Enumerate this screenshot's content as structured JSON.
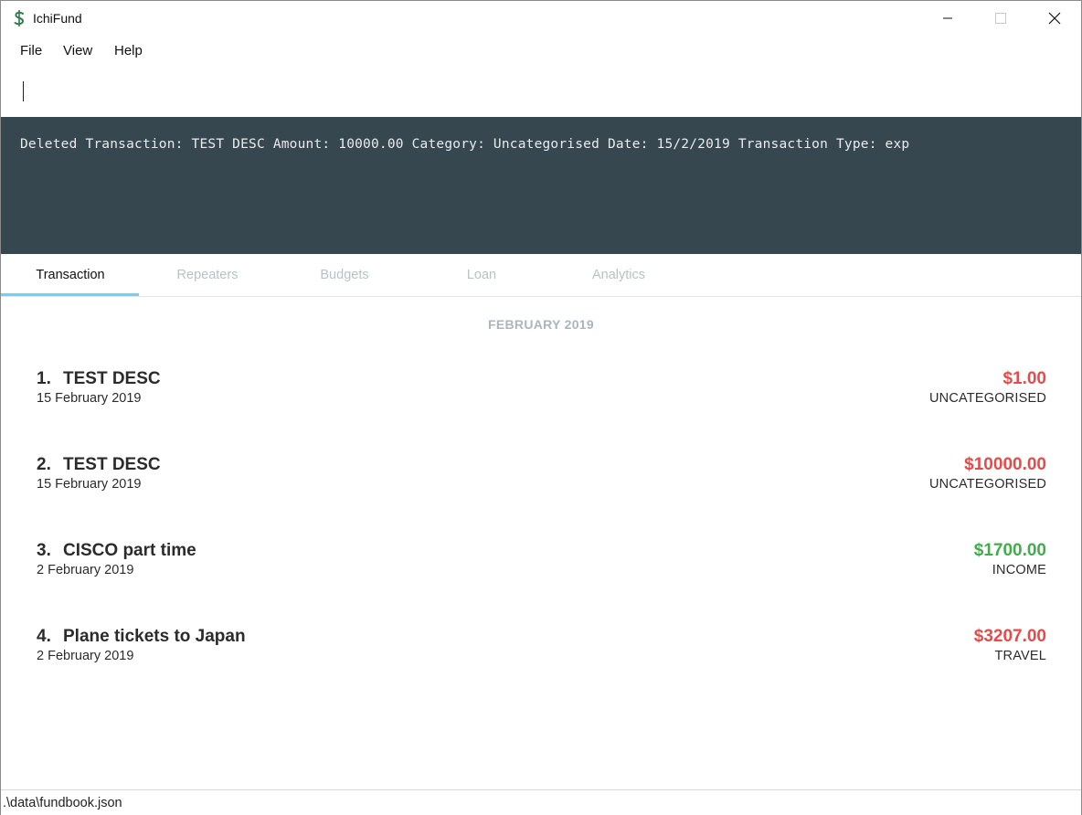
{
  "window": {
    "title": "IchiFund",
    "icon": "dollar-leaf-icon"
  },
  "menu": {
    "items": [
      {
        "label": "File"
      },
      {
        "label": "View"
      },
      {
        "label": "Help"
      }
    ]
  },
  "command": {
    "value": ""
  },
  "result": {
    "text": "Deleted Transaction: TEST DESC Amount: 10000.00 Category: Uncategorised Date: 15/2/2019 Transaction Type: exp"
  },
  "tabs": [
    {
      "label": "Transaction",
      "active": true
    },
    {
      "label": "Repeaters",
      "active": false
    },
    {
      "label": "Budgets",
      "active": false
    },
    {
      "label": "Loan",
      "active": false
    },
    {
      "label": "Analytics",
      "active": false
    }
  ],
  "transactions": {
    "month": "FEBRUARY 2019",
    "items": [
      {
        "index": "1.",
        "title": "TEST DESC",
        "date": "15 February 2019",
        "amount": "$1.00",
        "category": "UNCATEGORISED",
        "type": "expense"
      },
      {
        "index": "2.",
        "title": "TEST DESC",
        "date": "15 February 2019",
        "amount": "$10000.00",
        "category": "UNCATEGORISED",
        "type": "expense"
      },
      {
        "index": "3.",
        "title": "CISCO part time",
        "date": "2 February 2019",
        "amount": "$1700.00",
        "category": "INCOME",
        "type": "income"
      },
      {
        "index": "4.",
        "title": "Plane tickets to Japan",
        "date": "2 February 2019",
        "amount": "$3207.00",
        "category": "TRAVEL",
        "type": "expense"
      }
    ]
  },
  "status": {
    "file_path": ".\\data\\fundbook.json"
  },
  "colors": {
    "result_bg": "#37474f",
    "expense": "#e84a4a",
    "income": "#3fae4a",
    "tab_accent": "#7ecbf0"
  }
}
